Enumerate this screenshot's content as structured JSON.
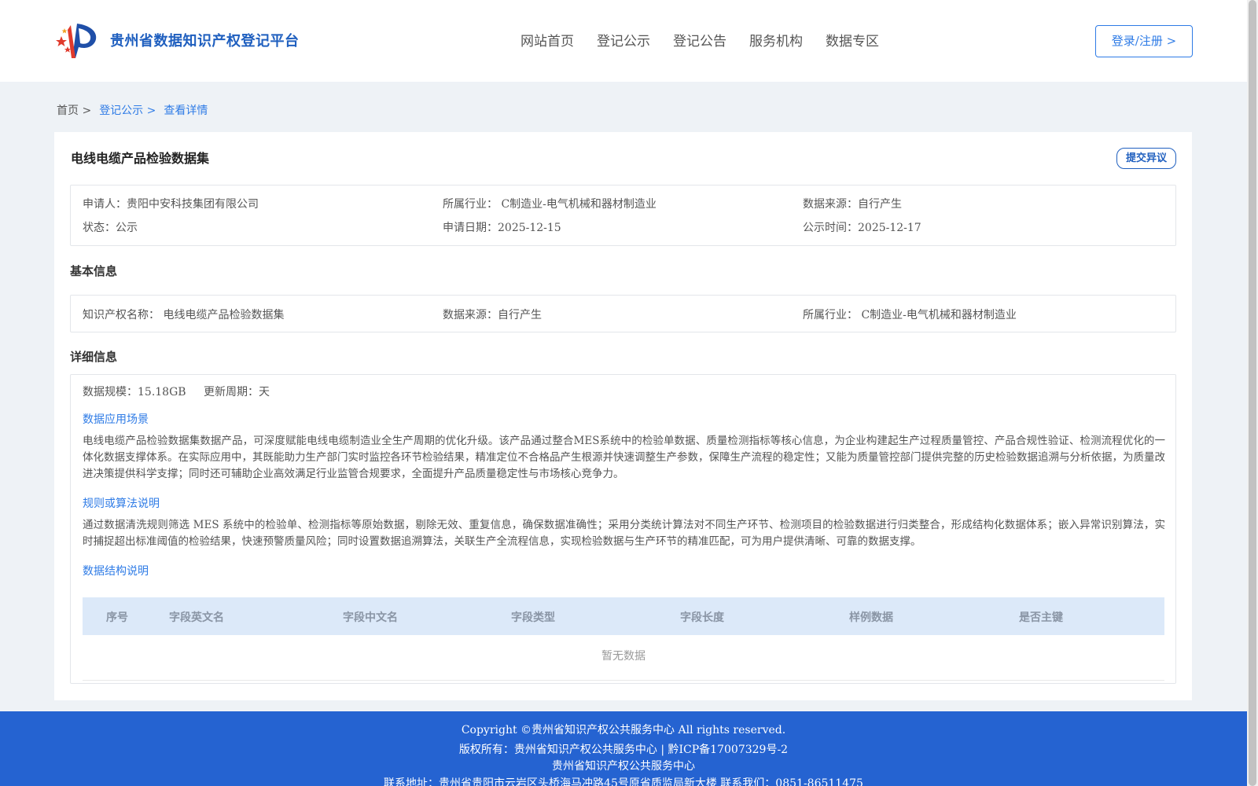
{
  "header": {
    "logo_text": "贵州省数据知识产权登记平台",
    "nav": [
      "网站首页",
      "登记公示",
      "登记公告",
      "服务机构",
      "数据专区"
    ],
    "login_label": "登录/注册 >"
  },
  "breadcrumb": {
    "home": "首页 >",
    "section": "登记公示 >",
    "current": "查看详情"
  },
  "dataset": {
    "title": "电线电缆产品检验数据集",
    "objection_label": "提交异议",
    "summary": {
      "applicant": "申请人：贵阳中安科技集团有限公司",
      "industry": "所属行业： C制造业-电气机械和器材制造业",
      "source": "数据来源：自行产生",
      "status": "状态：公示",
      "apply_date": "申请日期：2025-12-15",
      "publish_date": "公示时间：2025-12-17"
    }
  },
  "basic_info": {
    "heading": "基本信息",
    "ip_name": "知识产权名称： 电线电缆产品检验数据集",
    "source": "数据来源：自行产生",
    "industry": "所属行业： C制造业-电气机械和器材制造业"
  },
  "detail_info": {
    "heading": "详细信息",
    "scale": "数据规模：15.18GB",
    "update_cycle": "更新周期：天",
    "scenario_heading": "数据应用场景",
    "scenario_text": "电线电缆产品检验数据集数据产品，可深度赋能电线电缆制造业全生产周期的优化升级。该产品通过整合MES系统中的检验单数据、质量检测指标等核心信息，为企业构建起生产过程质量管控、产品合规性验证、检测流程优化的一体化数据支撑体系。在实际应用中，其既能助力生产部门实时监控各环节检验结果，精准定位不合格品产生根源并快速调整生产参数，保障生产流程的稳定性；又能为质量管控部门提供完整的历史检验数据追溯与分析依据，为质量改进决策提供科学支撑；同时还可辅助企业高效满足行业监管合规要求，全面提升产品质量稳定性与市场核心竞争力。",
    "rule_heading": "规则或算法说明",
    "rule_text": "通过数据清洗规则筛选 MES 系统中的检验单、检测指标等原始数据，剔除无效、重复信息，确保数据准确性；采用分类统计算法对不同生产环节、检测项目的检验数据进行归类整合，形成结构化数据体系；嵌入异常识别算法，实时捕捉超出标准阈值的检验结果，快速预警质量风险；同时设置数据追溯算法，关联生产全流程信息，实现检验数据与生产环节的精准匹配，可为用户提供清晰、可靠的数据支撑。",
    "structure_heading": "数据结构说明",
    "table_headers": [
      "序号",
      "字段英文名",
      "字段中文名",
      "字段类型",
      "字段长度",
      "样例数据",
      "是否主键"
    ],
    "empty_text": "暂无数据"
  },
  "footer": {
    "copyright": "Copyright ©贵州省知识产权公共服务中心 All rights reserved.",
    "owner": "版权所有：贵州省知识产权公共服务中心 | 黔ICP备17007329号-2",
    "org": "贵州省知识产权公共服务中心",
    "contact": "联系地址：贵州省贵阳市云岩区头桥海马冲路45号原省质监局新大楼 联系我们：0851-86511475"
  },
  "colors": {
    "brand": "#1f5fbf",
    "link": "#2e7be6",
    "footer_bg": "#2563d1",
    "table_head_bg": "#dce9f9"
  }
}
